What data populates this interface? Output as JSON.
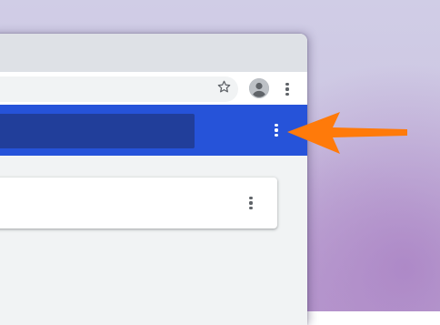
{
  "window": {
    "title": ""
  },
  "toolbar": {
    "bookmark_icon": "star-outline-icon",
    "profile_icon": "account-circle-icon",
    "menu_icon": "vertical-ellipsis-icon"
  },
  "app_header": {
    "menu_icon": "vertical-ellipsis-icon"
  },
  "card": {
    "menu_icon": "vertical-ellipsis-icon"
  },
  "annotation": {
    "arrow_color": "#ff7a0a"
  },
  "colors": {
    "header_blue": "#2653d9",
    "header_search_dark": "#213e9a",
    "tab_strip": "#dee1e6",
    "content_bg": "#f1f3f4"
  }
}
